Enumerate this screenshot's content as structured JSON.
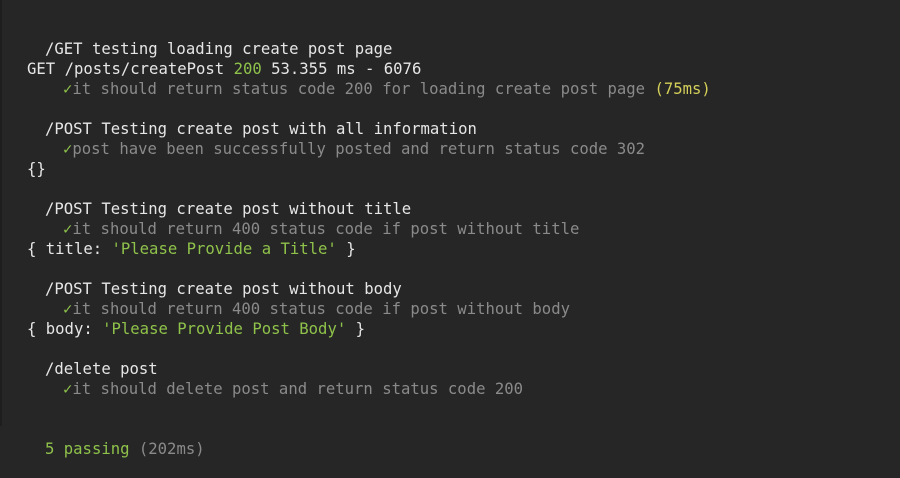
{
  "suites": [
    {
      "title": "/GET testing loading create post page",
      "log": {
        "method": "GET",
        "path": "/posts/createPost",
        "status": "200",
        "timing": "53.355 ms - 6076"
      },
      "test": "it should return status code 200 for loading create post page",
      "duration": "(75ms)"
    },
    {
      "title": "/POST Testing create post with all information",
      "test": "post have been successfully posted and return status code 302",
      "output": "{}"
    },
    {
      "title": "/POST Testing create post without title",
      "test": "it should return 400 status code if post without title",
      "output": {
        "open": "{ ",
        "key": "title: ",
        "value": "'Please Provide a Title'",
        "close": " }"
      }
    },
    {
      "title": "/POST Testing create post without body",
      "test": "it should return 400 status code if post without body",
      "output": {
        "open": "{ ",
        "key": "body: ",
        "value": "'Please Provide Post Body'",
        "close": " }"
      }
    },
    {
      "title": "/delete post",
      "test": "it should delete post and return status code 200"
    }
  ],
  "check_mark": "✓",
  "summary": {
    "passing": "5 passing",
    "duration": "(202ms)"
  },
  "colors": {
    "background": "#262626",
    "text": "#e6e6e6",
    "pass": "#8fc24a",
    "dim": "#8a8a8a",
    "slow": "#d4cf59"
  }
}
